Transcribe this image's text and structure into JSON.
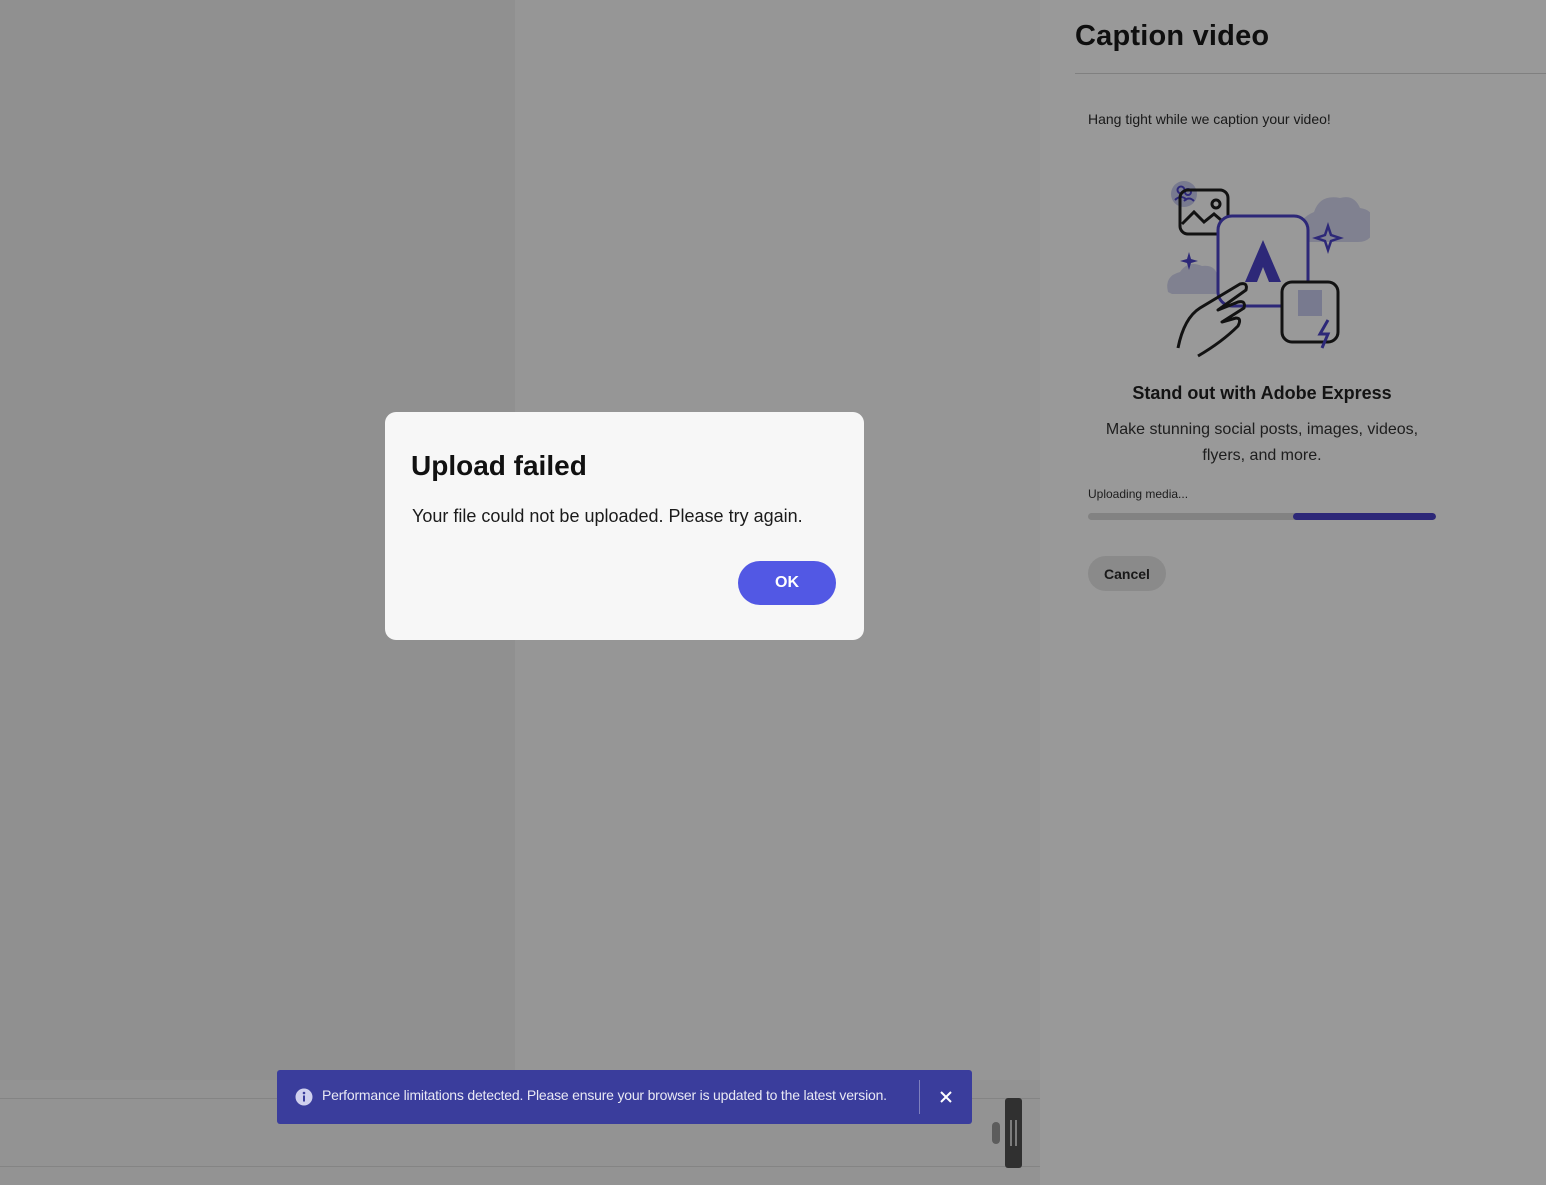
{
  "panel": {
    "title": "Caption video",
    "subtitle": "Hang tight while we caption your video!",
    "promo_title": "Stand out with Adobe Express",
    "promo_desc_line1": "Make stunning social posts, images, videos,",
    "promo_desc_line2": "flyers, and more.",
    "upload_label": "Uploading media...",
    "progress": {
      "indeterminate_segment_start": 0.59,
      "indeterminate_segment_end": 1.0
    },
    "cancel_label": "Cancel",
    "accent_color": "#4b43c9"
  },
  "dialog": {
    "title": "Upload failed",
    "message": "Your file could not be uploaded. Please try again.",
    "ok_label": "OK",
    "button_color": "#5258e4"
  },
  "toast": {
    "icon": "info-icon",
    "message": "Performance limitations detected. Please ensure your browser is updated to the latest version.",
    "close_icon": "close-icon",
    "background": "#3a3d9c"
  }
}
